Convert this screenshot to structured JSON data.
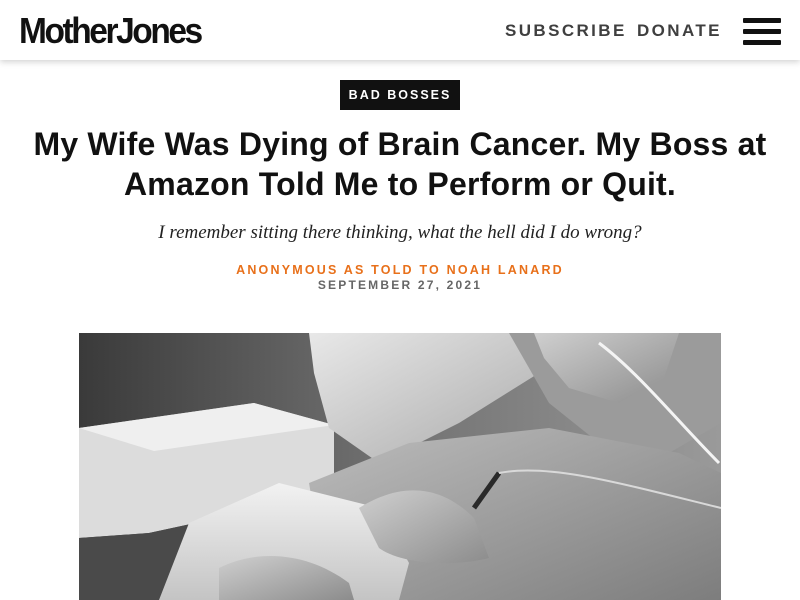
{
  "header": {
    "logo_text": "MotherJones",
    "nav": {
      "subscribe_label": "SUBSCRIBE",
      "donate_label": "DONATE"
    },
    "menu_icon": "hamburger-menu-icon"
  },
  "article": {
    "kicker": "BAD BOSSES",
    "headline": "My Wife Was Dying of Brain Cancer. My Boss at Amazon Told Me to Perform or Quit.",
    "dek": "I remember sitting there thinking, what the hell did I do wrong?",
    "byline": "ANONYMOUS AS TOLD TO NOAH LANARD",
    "date": "SEPTEMBER 27, 2021",
    "hero_image": "black-and-white-photo-of-patient-in-hospital-bed-with-iv-line"
  },
  "colors": {
    "byline_accent": "#e8701a",
    "kicker_bg": "#111111",
    "text": "#111111",
    "muted": "#666666"
  }
}
